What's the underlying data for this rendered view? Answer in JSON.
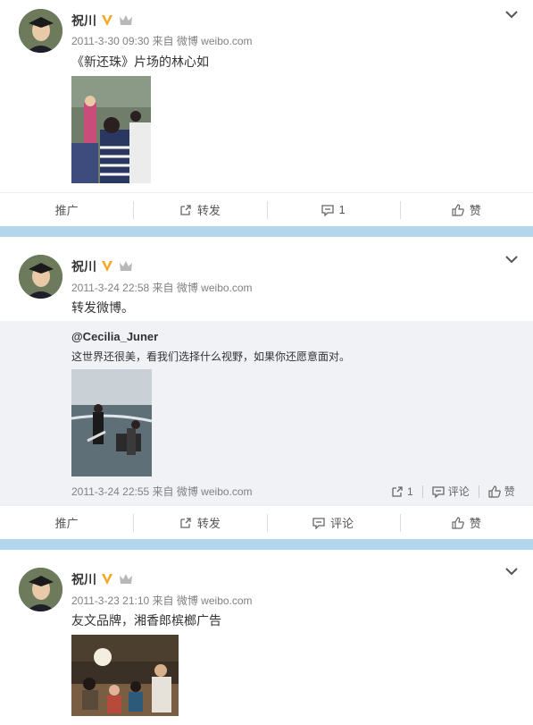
{
  "posts": [
    {
      "author": "祝川",
      "meta": "2011-3-30 09:30 来自 微博 weibo.com",
      "text": "《新还珠》片场的林心如",
      "actions": {
        "promote": "推广",
        "repost": "转发",
        "comment": "1",
        "like": "赞"
      }
    },
    {
      "author": "祝川",
      "meta": "2011-3-24 22:58 来自 微博 weibo.com",
      "text": "转发微博。",
      "repost": {
        "user": "@Cecilia_Juner",
        "text": "这世界还很美，看我们选择什么视野，如果你还愿意面对。",
        "meta": "2011-3-24 22:55 来自 微博 weibo.com",
        "repost_count": "1",
        "comment": "评论",
        "like": "赞"
      },
      "actions": {
        "promote": "推广",
        "repost": "转发",
        "comment": "评论",
        "like": "赞"
      }
    },
    {
      "author": "祝川",
      "meta": "2011-3-23 21:10 来自 微博 weibo.com",
      "text": "友文品牌，湘香郎槟榔广告"
    }
  ],
  "colors": {
    "background": "#b3d6ec",
    "verified": "#f6a623",
    "meta": "#808080"
  },
  "icons": [
    "verified-v-icon",
    "crown-icon",
    "chevron-down-icon",
    "share-icon",
    "comment-icon",
    "like-icon"
  ]
}
